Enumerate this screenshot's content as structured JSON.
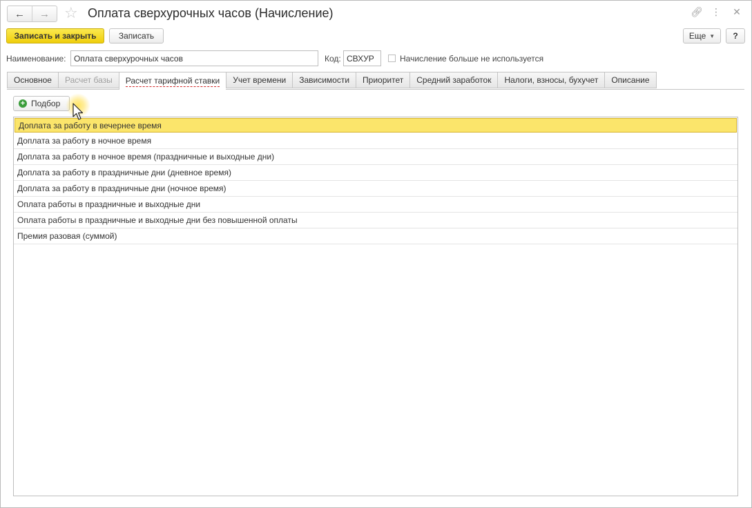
{
  "window": {
    "title": "Оплата сверхурочных часов (Начисление)",
    "nav": {
      "back_icon": "arrow-left-icon",
      "forward_icon": "arrow-right-icon"
    },
    "favorite_icon": "star-icon",
    "title_icons": [
      "link-icon",
      "more-vertical-icon",
      "close-icon"
    ]
  },
  "toolbar": {
    "save_close_label": "Записать и закрыть",
    "save_label": "Записать",
    "more_label": "Еще",
    "help_label": "?"
  },
  "fields": {
    "name_label": "Наименование:",
    "name_value": "Оплата сверхурочных часов",
    "code_label": "Код:",
    "code_value": "СВХУР",
    "not_used_label": "Начисление больше не используется",
    "not_used_checked": false
  },
  "tabs": [
    {
      "label": "Основное",
      "state": "normal"
    },
    {
      "label": "Расчет базы",
      "state": "disabled"
    },
    {
      "label": "Расчет тарифной ставки",
      "state": "active"
    },
    {
      "label": "Учет времени",
      "state": "normal"
    },
    {
      "label": "Зависимости",
      "state": "normal"
    },
    {
      "label": "Приоритет",
      "state": "normal"
    },
    {
      "label": "Средний заработок",
      "state": "normal"
    },
    {
      "label": "Налоги, взносы, бухучет",
      "state": "normal"
    },
    {
      "label": "Описание",
      "state": "normal"
    }
  ],
  "pick_button": {
    "label": "Подбор",
    "icon": "plus-circle-icon"
  },
  "list": {
    "items": [
      "Доплата за работу в вечернее время",
      "Доплата за работу в ночное время",
      "Доплата за работу в ночное время (праздничные и выходные дни)",
      "Доплата за работу в праздничные дни (дневное время)",
      "Доплата за работу в праздничные дни (ночное время)",
      "Оплата работы в праздничные и выходные дни",
      "Оплата работы в праздничные и выходные дни без повышенной оплаты",
      "Премия разовая (суммой)"
    ],
    "selected_index": 0
  },
  "colors": {
    "primary_button": "#f5dc2a",
    "selected_row": "#fbe56b",
    "active_tab_underline": "#d12a2a"
  }
}
